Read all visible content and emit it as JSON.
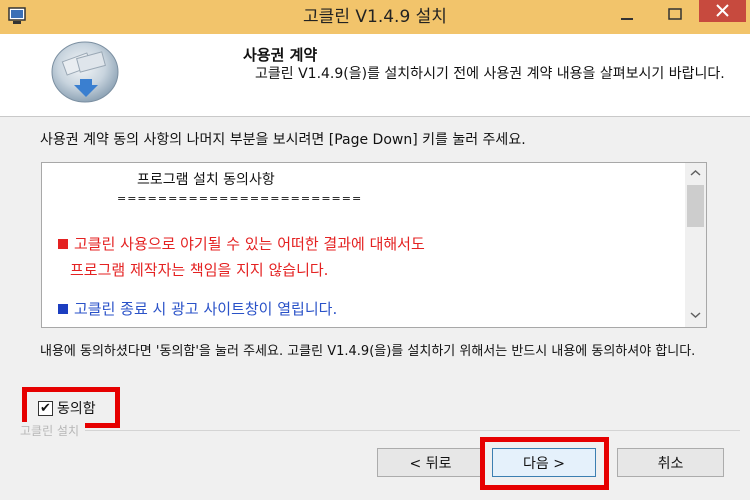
{
  "window": {
    "title": "고클린 V1.4.9 설치",
    "icons": {
      "app": "computer-icon",
      "minimize": "minimize-icon",
      "maximize": "maximize-icon",
      "close": "close-icon"
    }
  },
  "header": {
    "title": "사용권 계약",
    "description": "고클린 V1.4.9(을)를 설치하시기 전에 사용권 계약 내용을 살펴보시기 바랍니다."
  },
  "body": {
    "instruction": "사용권 계약 동의 사항의 나머지 부분을 보시려면 [Page Down] 키를 눌러 주세요.",
    "license": {
      "title": "프로그램 설치 동의사항",
      "separator": "========================",
      "red_line1": "고클린 사용으로 야기될 수 있는 어떠한 결과에 대해서도",
      "red_line2": "프로그램 제작자는 책임을 지지 않습니다.",
      "blue_line": "고클린 종료 시 광고 사이트창이 열립니다."
    },
    "agree_instruction": "내용에 동의하셨다면 '동의함'을 눌러 주세요. 고클린 V1.4.9(을)를 설치하기 위해서는 반드시 내용에 동의하셔야 합니다.",
    "checkbox": {
      "label": "동의함",
      "checked": true,
      "mark": "✔"
    },
    "brand": "고클린 설치"
  },
  "buttons": {
    "back": "< 뒤로",
    "next": "다음 >",
    "cancel": "취소"
  },
  "colors": {
    "titlebar": "#f2c46b",
    "close_button": "#c74a3e",
    "highlight": "#e60000",
    "warning_text": "#e42222",
    "info_text": "#2a52c8"
  }
}
